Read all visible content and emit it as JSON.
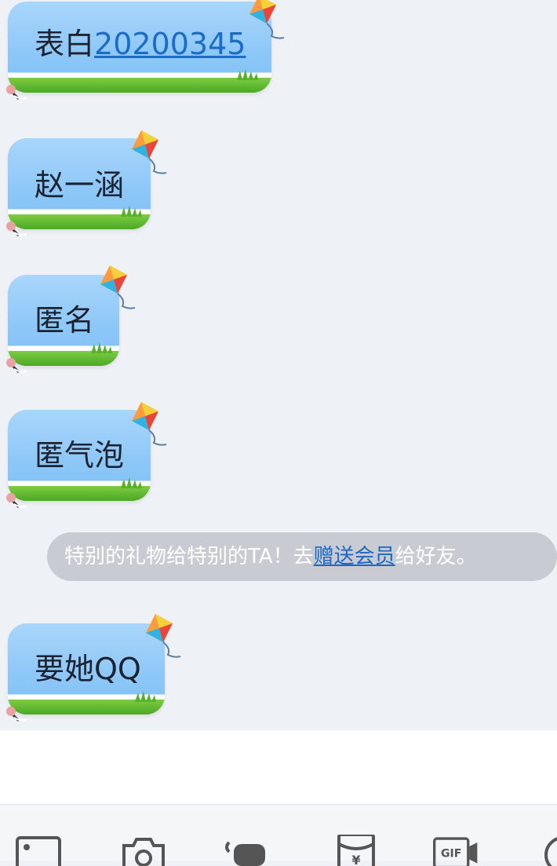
{
  "messages": [
    {
      "prefix": "表白",
      "link": "20200345"
    },
    {
      "text": "赵一涵"
    },
    {
      "text": "匿名"
    },
    {
      "text": "匿气泡"
    },
    {
      "text": "要她QQ"
    }
  ],
  "notice": {
    "before": "特别的礼物给特别的TA！去",
    "link": "赠送会员",
    "after": "给好友。"
  },
  "toolbar": {
    "gif_label": "GIF",
    "items": [
      "image-icon",
      "camera-icon",
      "hand-icon",
      "red-packet-icon",
      "gif-icon",
      "more-icon"
    ]
  },
  "colors": {
    "background": "#eef1f6",
    "bubble_sky": "#8ec8f8",
    "bubble_grass": "#4aa923",
    "link": "#1b6cc9",
    "notice_bg": "#c8ccd2"
  }
}
